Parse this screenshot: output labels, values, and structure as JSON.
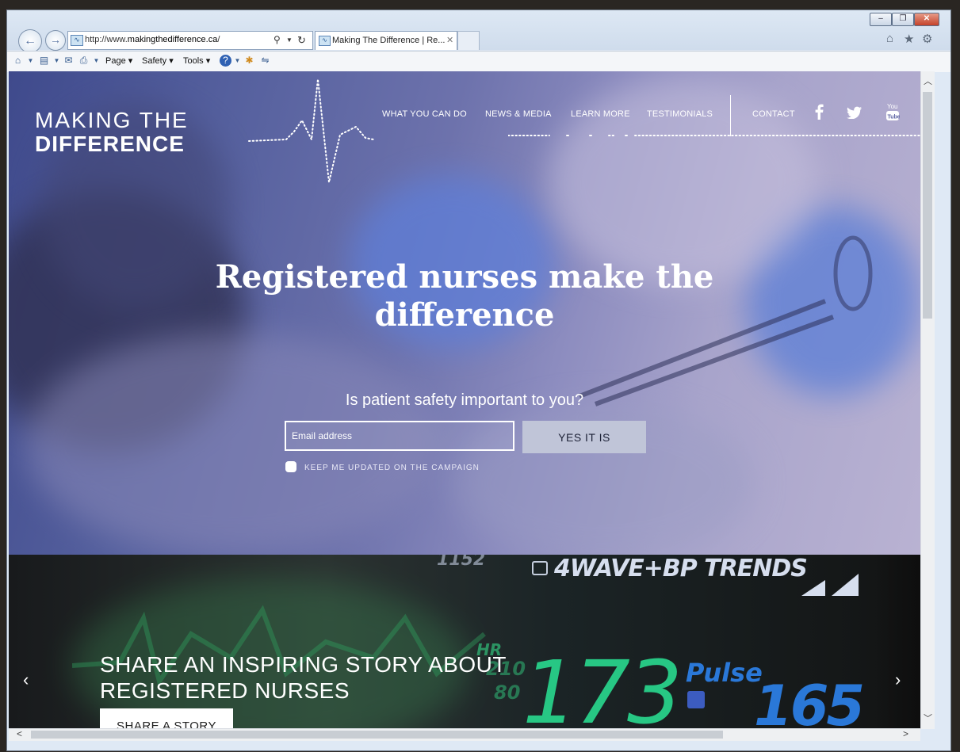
{
  "browser": {
    "url_prefix": "http://www.",
    "url_domain": "makingthedifference.ca",
    "url_suffix": "/",
    "tab_title": "Making The Difference | Re...",
    "command_bar": {
      "page": "Page ▾",
      "safety": "Safety ▾",
      "tools": "Tools ▾"
    },
    "icons": [
      "home-icon",
      "favorites-star-icon",
      "settings-gear-icon",
      "search-icon",
      "refresh-icon",
      "feeds-icon",
      "mail-icon",
      "print-icon",
      "help-icon"
    ]
  },
  "site": {
    "logo_line1": "MAKING THE",
    "logo_line2": "DIFFERENCE",
    "nav": {
      "what_you_can_do": "WHAT YOU CAN DO",
      "news_media": "NEWS & MEDIA",
      "learn_more": "LEARN MORE",
      "testimonials": "TESTIMONIALS",
      "contact": "CONTACT"
    },
    "social": [
      "facebook-icon",
      "twitter-icon",
      "youtube-icon"
    ]
  },
  "hero": {
    "headline": "Registered nurses make the difference",
    "question": "Is patient safety important to you?",
    "email_placeholder": "Email address",
    "submit_label": "YES IT IS",
    "checkbox_label": "KEEP ME UPDATED ON THE CAMPAIGN"
  },
  "slider": {
    "monitor_top": "1152",
    "monitor_header": "4WAVE+BP TRENDS",
    "monitor_hr_label": "HR",
    "monitor_bp1": "210",
    "monitor_bp2": "80",
    "monitor_big": "173",
    "monitor_pulse_label": "Pulse",
    "monitor_pulse": "165",
    "title_line1": "SHARE AN INSPIRING STORY ABOUT",
    "title_line2": "REGISTERED NURSES",
    "cta": "SHARE A STORY"
  },
  "colors": {
    "hero_tint": "#5d63a3",
    "monitor_green": "#27c784",
    "monitor_blue": "#2a78d8"
  }
}
